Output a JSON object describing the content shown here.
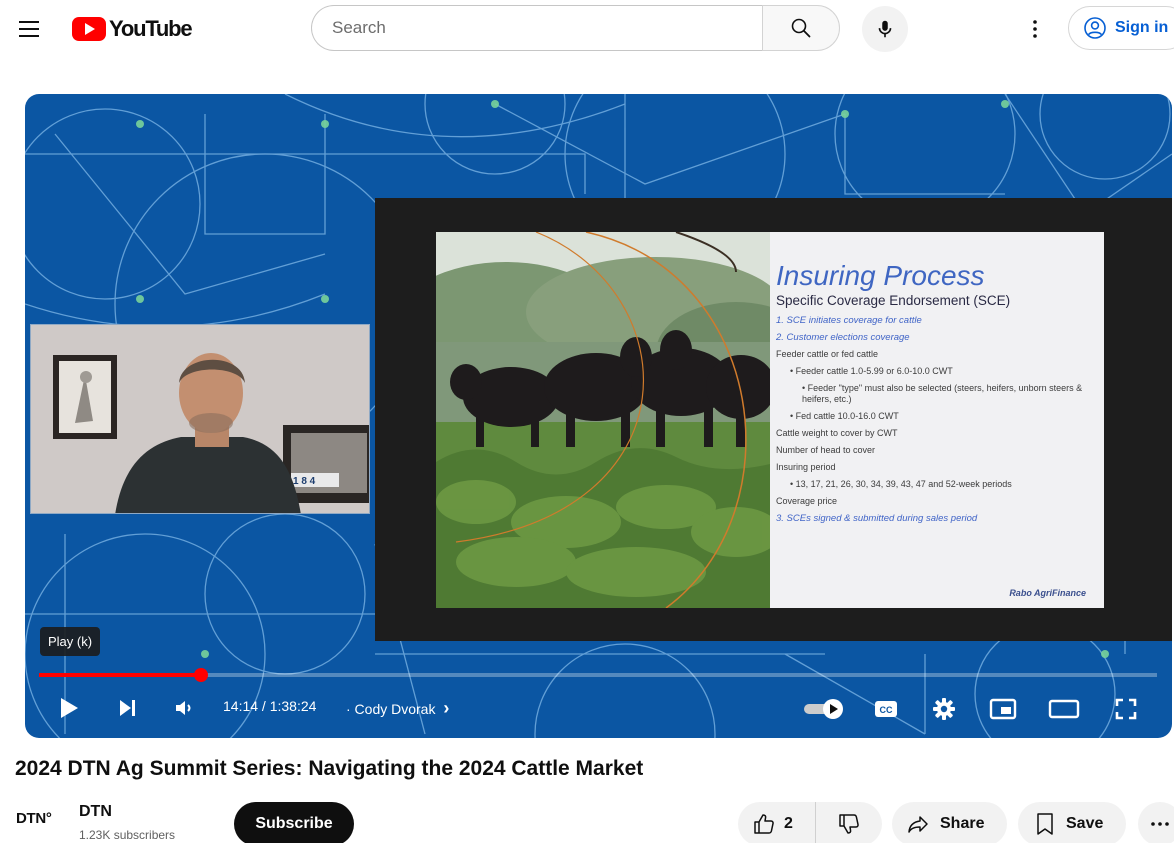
{
  "header": {
    "logo_text": "YouTube",
    "search_placeholder": "Search",
    "signin_label": "Sign in"
  },
  "player": {
    "tooltip": "Play (k)",
    "current_time": "14:14",
    "duration": "1:38:24",
    "time_display": "14:14 / 1:38:24",
    "chapter_label": "· Cody Dvorak",
    "chapter_chevron": "›",
    "progress_fraction": 0.145,
    "autoplay_on": true,
    "cc_label": "CC",
    "webcam_sign_text": "1 8 4"
  },
  "slide": {
    "title": "Insuring Process",
    "subtitle": "Specific Coverage Endorsement (SCE)",
    "items": [
      {
        "text": "1.  SCE initiates coverage for cattle",
        "style": "blue"
      },
      {
        "text": "2.  Customer elections coverage",
        "style": "blue"
      },
      {
        "text": "Feeder cattle or fed cattle",
        "style": "plain"
      },
      {
        "text": "•  Feeder cattle 1.0-5.99 or 6.0-10.0 CWT",
        "style": "l1"
      },
      {
        "text": "•  Feeder \"type\" must also be selected (steers, heifers, unborn steers & heifers, etc.)",
        "style": "l2"
      },
      {
        "text": "•  Fed cattle 10.0-16.0 CWT",
        "style": "l1"
      },
      {
        "text": "Cattle weight to cover by CWT",
        "style": "plain"
      },
      {
        "text": "Number of head to cover",
        "style": "plain"
      },
      {
        "text": "Insuring period",
        "style": "plain"
      },
      {
        "text": "•  13, 17, 21, 26, 30, 34, 39, 43, 47 and 52-week periods",
        "style": "l1"
      },
      {
        "text": "Coverage price",
        "style": "plain"
      },
      {
        "text": "3.  SCEs signed & submitted during sales period",
        "style": "blue"
      }
    ],
    "brand": "Rabo AgriFinance"
  },
  "video": {
    "title": "2024 DTN Ag Summit Series: Navigating the 2024 Cattle Market"
  },
  "channel": {
    "logo_text": "DTN°",
    "name": "DTN",
    "subscribers": "1.23K subscribers",
    "subscribe_label": "Subscribe"
  },
  "actions": {
    "like_count": "2",
    "share_label": "Share",
    "save_label": "Save"
  },
  "colors": {
    "brand_red": "#ff0000",
    "link_blue": "#065fd4",
    "player_blue": "#0b56a3",
    "slide_title_blue": "#3f66c2"
  },
  "icons": [
    "menu-icon",
    "search-icon",
    "mic-icon",
    "more-vert-icon",
    "account-circle-icon",
    "play-icon",
    "next-icon",
    "volume-icon",
    "autoplay-toggle-icon",
    "cc-icon",
    "settings-icon",
    "miniplayer-icon",
    "theater-icon",
    "fullscreen-icon",
    "thumb-up-icon",
    "thumb-down-icon",
    "share-icon",
    "save-icon",
    "more-horiz-icon"
  ]
}
